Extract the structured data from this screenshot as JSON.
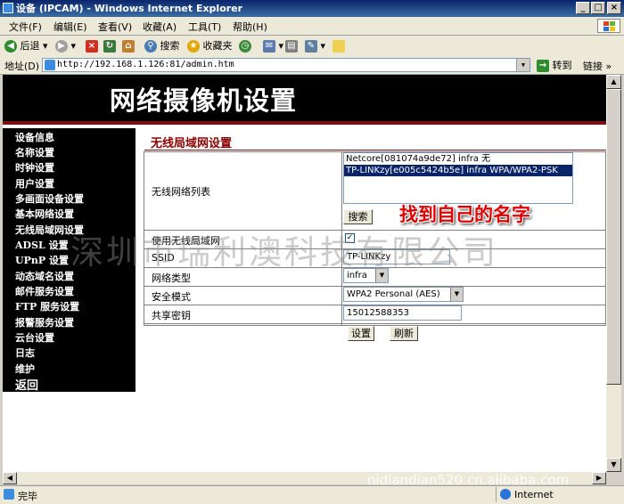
{
  "window": {
    "title": "设备 (IPCAM) - Windows Internet Explorer"
  },
  "menu": [
    "文件(F)",
    "编辑(E)",
    "查看(V)",
    "收藏(A)",
    "工具(T)",
    "帮助(H)"
  ],
  "toolbar": {
    "back": "后退",
    "search": "搜索",
    "favorites": "收藏夹"
  },
  "address": {
    "label": "地址(D)",
    "url": "http://192.168.1.126:81/admin.htm",
    "go": "转到",
    "links": "链接"
  },
  "page": {
    "banner_title": "网络摄像机设置",
    "sidebar": [
      "设备信息",
      "名称设置",
      "时钟设置",
      "用户设置",
      "多画面设备设置",
      "基本网络设置",
      "无线局域网设置",
      "ADSL 设置",
      "UPnP 设置",
      "动态域名设置",
      "邮件服务设置",
      "FTP 服务设置",
      "报警服务设置",
      "云台设置",
      "日志",
      "维护",
      "返回"
    ],
    "section_title": "无线局域网设置",
    "form": {
      "wifi_list_label": "无线网络列表",
      "networks": [
        "Netcore[081074a9de72] infra 无",
        "TP-LINKzy[e005c5424b5e] infra WPA/WPA2-PSK"
      ],
      "search_button": "搜索",
      "enable_label": "使用无线局域网",
      "ssid_label": "SSID",
      "ssid_value": "TP-LINKzy",
      "net_type_label": "网络类型",
      "net_type_value": "infra",
      "security_label": "安全模式",
      "security_value": "WPA2 Personal (AES)",
      "key_label": "共享密钥",
      "key_value": "15012588353",
      "set_button": "设置",
      "refresh_button": "刷新"
    },
    "annotation": "找到自己的名字",
    "watermark": "深圳市瑞利澳科技有限公司",
    "watermark_url": "nidiandian520.cn.alibaba.com"
  },
  "status": {
    "text": "完毕",
    "zone": "Internet"
  },
  "colors": {
    "banner": "#000000",
    "accent": "#7a1010",
    "section_title": "#8b0000",
    "annotation": "#e00000",
    "selection": "#0a246a"
  }
}
